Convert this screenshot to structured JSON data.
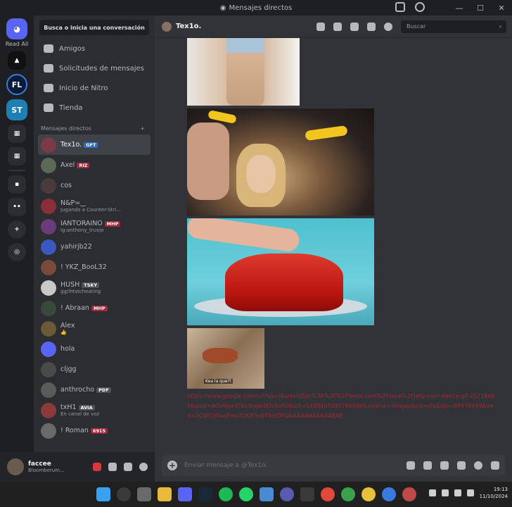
{
  "window": {
    "title": "Mensajes directos"
  },
  "guilds": {
    "read_all": "Read All",
    "items": [
      "FL",
      "ST"
    ]
  },
  "sidebar": {
    "search_placeholder": "Busca o inicia una conversación",
    "nav": [
      "Amigos",
      "Solicitudes de mensajes",
      "Inicio de Nitro",
      "Tienda"
    ],
    "dm_header": "Mensajes directos",
    "dm_add": "+",
    "dms": [
      {
        "name": "Tex1o.",
        "tag": "GFT",
        "status": ""
      },
      {
        "name": "Axel",
        "tag": "RIZ",
        "status": ""
      },
      {
        "name": "cos",
        "tag": "",
        "status": ""
      },
      {
        "name": "N&P=‿",
        "tag": "",
        "status": "Jugando a Counter-Stri..."
      },
      {
        "name": "IANTORAINO",
        "tag": "MHP",
        "status": "ig:anthony_truxjo"
      },
      {
        "name": "yahirjb22",
        "tag": "",
        "status": ""
      },
      {
        "name": "! YKZ_BooL32",
        "tag": "",
        "status": ""
      },
      {
        "name": "HUSH",
        "tag": "TSKY",
        "status": "gg/ihtstcheating"
      },
      {
        "name": "! Abraan",
        "tag": "MHP",
        "status": ""
      },
      {
        "name": "Alex",
        "tag": "",
        "status": "👍"
      },
      {
        "name": "hola",
        "tag": "",
        "status": ""
      },
      {
        "name": "cljgg",
        "tag": "",
        "status": ""
      },
      {
        "name": "anthrocho",
        "tag": "PDF",
        "status": ""
      },
      {
        "name": "txH1",
        "tag": "AVIA",
        "status": "En canal de voz"
      },
      {
        "name": "! Roman",
        "tag": "6915",
        "status": ""
      }
    ]
  },
  "user": {
    "name": "faccee",
    "status": "Bloomberum..."
  },
  "chat": {
    "recipient": "Tex1o.",
    "search_placeholder": "Buscar",
    "gif_caption": "Kea la que?!",
    "link_text": "https://www.google.com/url?sa=i&url=https%3A%2F%2Ftenor.com%2Fview%2Fjelly-corn-dance-gif-25218465&psig=AOvVaw3Tbc0nge4KtrSoP0&ust=1698467092786000&source=images&cd=vfe&opi=89978449&ved=0CBEQjRxqFwoTCKjK5s6T4oIDFQAAAAAdAAAAABAE",
    "composer_placeholder": "Enviar mensaje a @Tex1o."
  },
  "taskbar": {
    "time": "19:13",
    "date": "11/10/2024"
  },
  "colors": {
    "accent": "#5865f2",
    "link_red": "#a3282e",
    "danger": "#da373c"
  }
}
